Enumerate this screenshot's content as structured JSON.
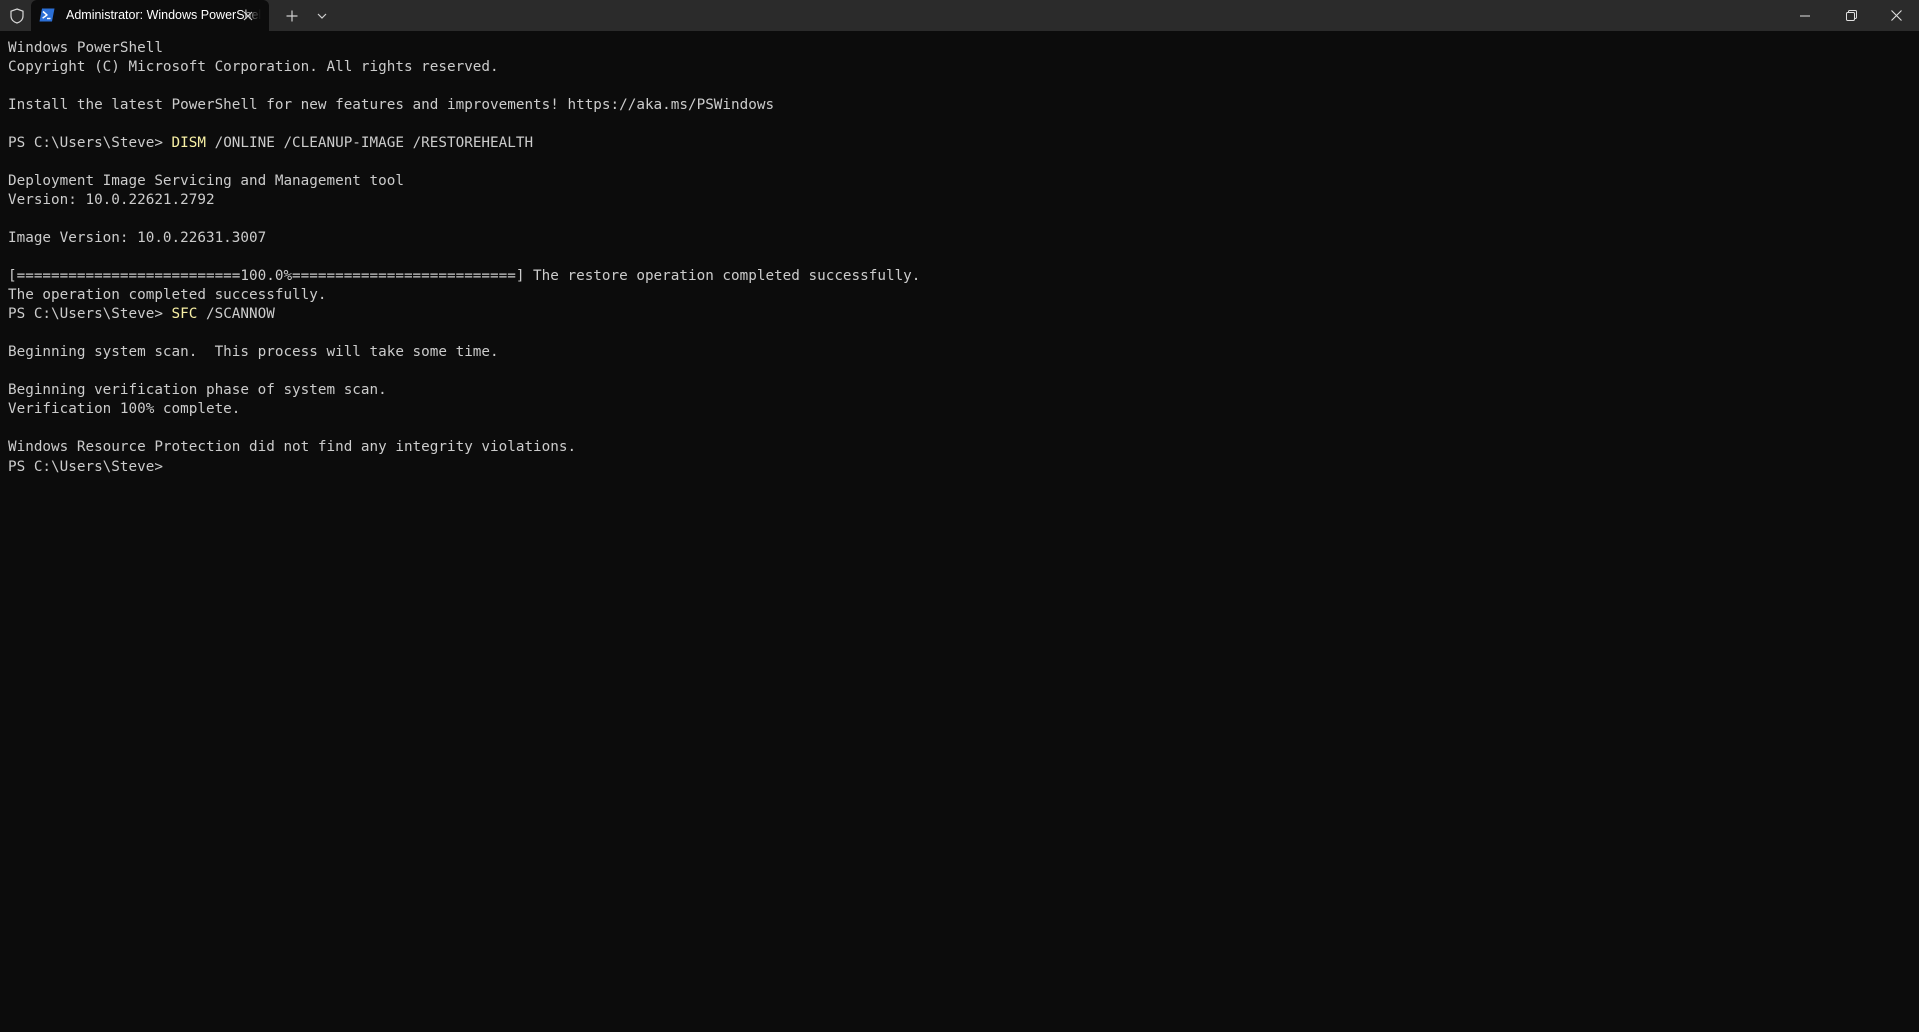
{
  "window": {
    "tab_title": "Administrator: Windows PowerShell",
    "icons": {
      "shield": "shield-icon",
      "tab": "powershell-icon",
      "tab_close": "close-icon",
      "new_tab": "plus-icon",
      "dropdown": "chevron-down-icon",
      "minimize": "minimize-icon",
      "maximize": "restore-icon",
      "close": "close-icon"
    }
  },
  "colors": {
    "background": "#0c0c0c",
    "titlebar": "#2b2b2b",
    "text": "#cccccc",
    "command": "#f9f1a5"
  },
  "terminal": {
    "lines": [
      {
        "text": "Windows PowerShell"
      },
      {
        "text": "Copyright (C) Microsoft Corporation. All rights reserved."
      },
      {
        "text": ""
      },
      {
        "text": "Install the latest PowerShell for new features and improvements! https://aka.ms/PSWindows"
      },
      {
        "text": ""
      },
      {
        "prompt": "PS C:\\Users\\Steve> ",
        "command": "DISM",
        "args": " /ONLINE /CLEANUP-IMAGE /RESTOREHEALTH"
      },
      {
        "text": ""
      },
      {
        "text": "Deployment Image Servicing and Management tool"
      },
      {
        "text": "Version: 10.0.22621.2792"
      },
      {
        "text": ""
      },
      {
        "text": "Image Version: 10.0.22631.3007"
      },
      {
        "text": ""
      },
      {
        "text": "[==========================100.0%==========================] The restore operation completed successfully."
      },
      {
        "text": "The operation completed successfully."
      },
      {
        "prompt": "PS C:\\Users\\Steve> ",
        "command": "SFC",
        "args": " /SCANNOW"
      },
      {
        "text": ""
      },
      {
        "text": "Beginning system scan.  This process will take some time."
      },
      {
        "text": ""
      },
      {
        "text": "Beginning verification phase of system scan."
      },
      {
        "text": "Verification 100% complete."
      },
      {
        "text": ""
      },
      {
        "text": "Windows Resource Protection did not find any integrity violations."
      },
      {
        "prompt": "PS C:\\Users\\Steve> ",
        "command": "",
        "args": ""
      }
    ]
  }
}
